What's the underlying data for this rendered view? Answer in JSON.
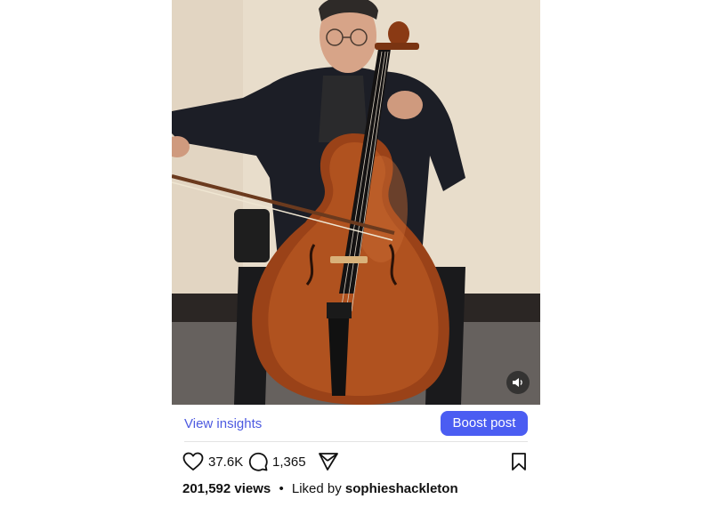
{
  "post": {
    "media": {
      "mute_icon": "speaker-icon"
    },
    "insights": {
      "view_label": "View insights",
      "boost_label": "Boost post"
    },
    "actions": {
      "like_icon": "heart-icon",
      "like_count": "37.6K",
      "comment_icon": "comment-bubble-icon",
      "comment_count": "1,365",
      "share_icon": "send-icon",
      "save_icon": "bookmark-icon"
    },
    "stats": {
      "views": "201,592 views",
      "separator": "•",
      "liked_by_label": "Liked by",
      "liked_by_user": "sophieshackleton"
    }
  },
  "colors": {
    "accent_link": "#4d5ae0",
    "boost_button": "#4b5df2",
    "text": "#111111"
  }
}
